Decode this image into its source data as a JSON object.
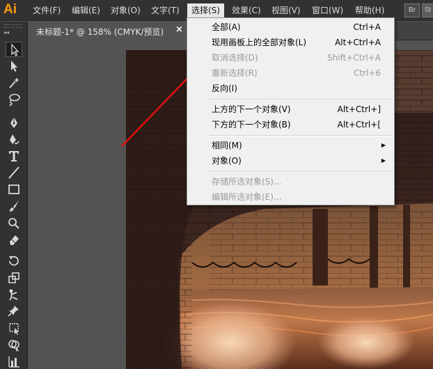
{
  "app": {
    "logo": "Ai",
    "menu": [
      "文件(F)",
      "编辑(E)",
      "对象(O)",
      "文字(T)",
      "选择(S)",
      "效果(C)",
      "视图(V)",
      "窗口(W)",
      "帮助(H)"
    ],
    "bridge_label": "Br",
    "stock_label": "St"
  },
  "tools_panel": {
    "collapse_glyph": "◂◂",
    "tools": [
      "selection-tool",
      "direct-selection-tool",
      "magic-wand-tool",
      "lasso-tool",
      "pen-tool",
      "curvature-tool",
      "type-tool",
      "line-segment-tool",
      "rectangle-tool",
      "paintbrush-tool",
      "shaper-tool",
      "eraser-tool",
      "rotate-tool",
      "scale-tool",
      "puppet-warp-tool",
      "pin-tool",
      "free-transform-tool",
      "graph-tool"
    ]
  },
  "document": {
    "tab_title": "未标题-1* @ 158% (CMYK/预览)",
    "close_glyph": "×"
  },
  "select_menu": {
    "items": [
      {
        "label": "全部(A)",
        "shortcut": "Ctrl+A",
        "enabled": true
      },
      {
        "label": "现用画板上的全部对象(L)",
        "shortcut": "Alt+Ctrl+A",
        "enabled": true
      },
      {
        "label": "取消选择(D)",
        "shortcut": "Shift+Ctrl+A",
        "enabled": false
      },
      {
        "label": "重新选择(R)",
        "shortcut": "Ctrl+6",
        "enabled": false
      },
      {
        "label": "反向(I)",
        "shortcut": "",
        "enabled": true
      },
      {
        "label": "上方的下一个对象(V)",
        "shortcut": "Alt+Ctrl+]",
        "enabled": true
      },
      {
        "label": "下方的下一个对象(B)",
        "shortcut": "Alt+Ctrl+[",
        "enabled": true
      },
      {
        "label": "相同(M)",
        "submenu_arrow": "▶",
        "enabled": true
      },
      {
        "label": "对象(O)",
        "submenu_arrow": "▶",
        "enabled": true
      },
      {
        "label": "存储所选对象(S)...",
        "shortcut": "",
        "enabled": false
      },
      {
        "label": "编辑所选对象(E)...",
        "shortcut": "",
        "enabled": false
      }
    ]
  },
  "colors": {
    "menubar": "#323232",
    "canvas": "#535353",
    "logo": "#ff9a00",
    "annotation_arrow": "#e01010"
  }
}
